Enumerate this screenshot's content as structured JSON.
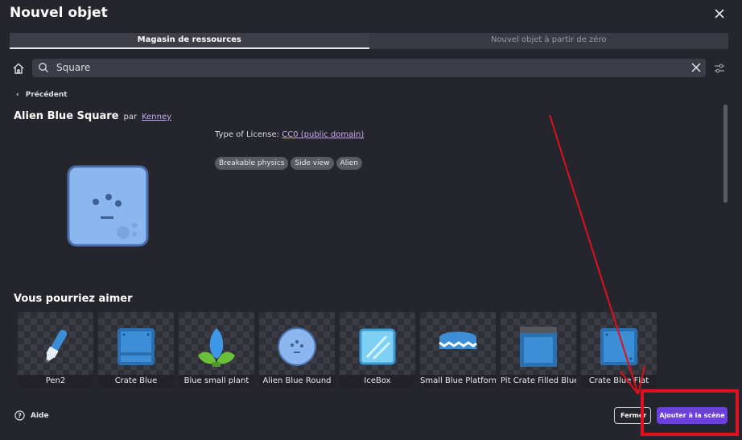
{
  "dialog": {
    "title": "Nouvel objet"
  },
  "tabs": [
    {
      "label": "Magasin de ressources",
      "active": true
    },
    {
      "label": "Nouvel objet à partir de zéro",
      "active": false
    }
  ],
  "search": {
    "value": "Square"
  },
  "nav": {
    "back_label": "Précédent"
  },
  "asset": {
    "name": "Alien Blue Square",
    "by_label": "par",
    "author": "Kenney",
    "license_label": "Type of License:",
    "license_value": "CC0 (public domain)",
    "tags": [
      "Breakable physics",
      "Side view",
      "Alien"
    ]
  },
  "suggestions": {
    "heading": "Vous pourriez aimer",
    "items": [
      {
        "label": "Pen2",
        "icon": "pen-icon"
      },
      {
        "label": "Crate Blue",
        "icon": "crate-icon"
      },
      {
        "label": "Blue small plant",
        "icon": "plant-icon"
      },
      {
        "label": "Alien Blue Round",
        "icon": "alien-round-icon"
      },
      {
        "label": "IceBox",
        "icon": "icebox-icon"
      },
      {
        "label": "Small Blue Platform",
        "icon": "platform-icon"
      },
      {
        "label": "Pit Crate Filled Blue",
        "icon": "pit-crate-icon"
      },
      {
        "label": "Crate Blue Flat",
        "icon": "crate-flat-icon"
      }
    ]
  },
  "footer": {
    "help_label": "Aide",
    "close_label": "Fermer",
    "add_label": "Ajouter à la scène"
  },
  "colors": {
    "accent": "#6b3fe0",
    "link": "#c9a8f0",
    "annotation": "#e0101c"
  }
}
